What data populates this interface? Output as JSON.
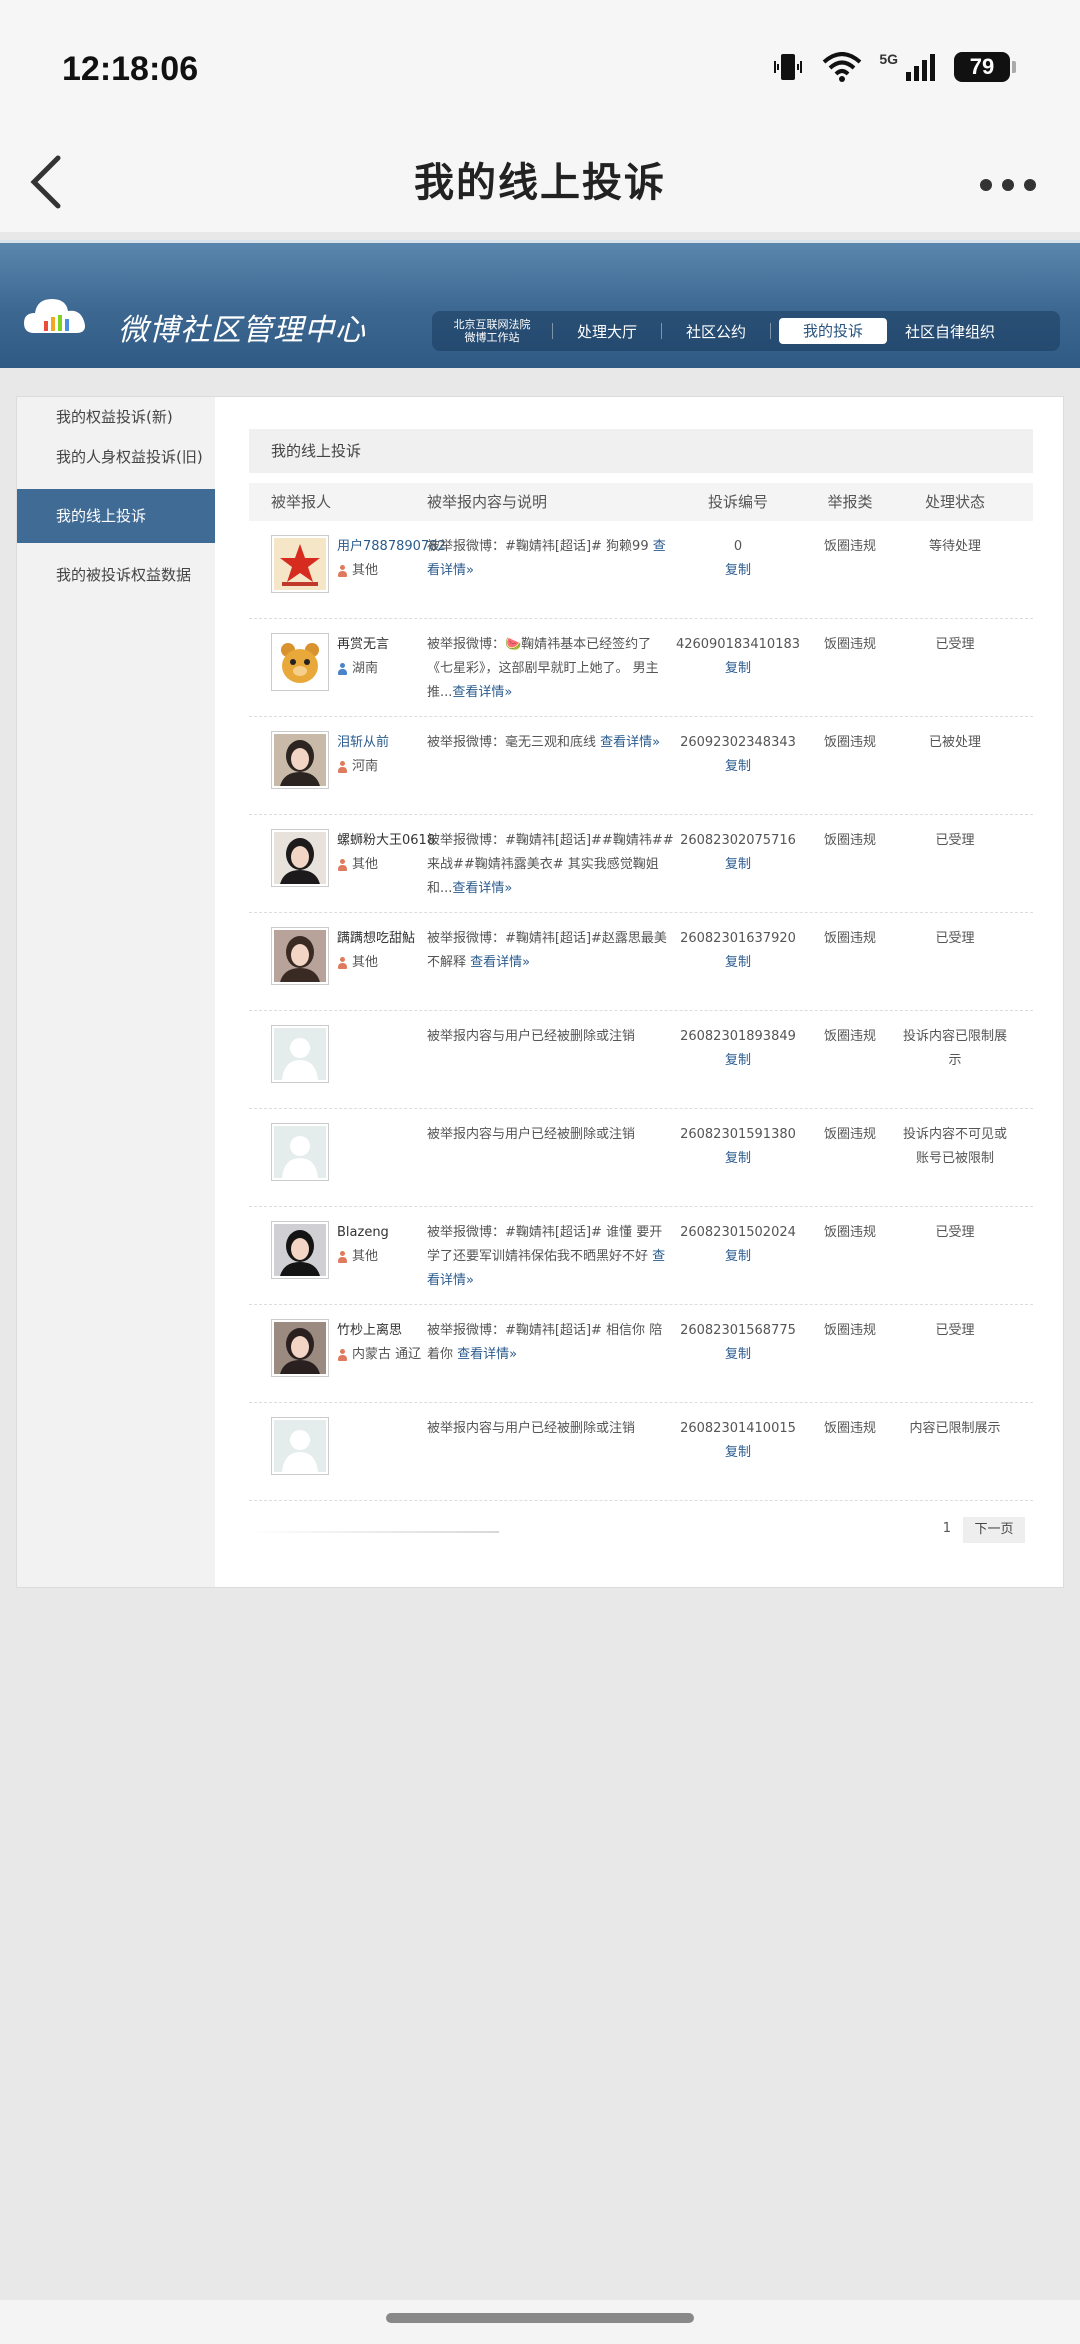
{
  "status_bar": {
    "time": "12:18:06",
    "network": "5G",
    "battery": "79"
  },
  "nav": {
    "title": "我的线上投诉"
  },
  "banner": {
    "title": "微博社区管理中心",
    "court_line1": "北京互联网法院",
    "court_line2": "微博工作站",
    "tabs": [
      "处理大厅",
      "社区公约",
      "我的投诉",
      "社区自律组织"
    ],
    "active_tab": "我的投诉"
  },
  "sidebar": {
    "items": [
      "我的权益投诉(新)",
      "我的人身权益投诉(旧)",
      "我的线上投诉",
      "我的被投诉权益数据"
    ],
    "active": "我的线上投诉"
  },
  "content": {
    "title": "我的线上投诉",
    "headers": [
      "被举报人",
      "被举报内容与说明",
      "投诉编号",
      "举报类",
      "处理状态"
    ],
    "copy_label": "复制",
    "rows": [
      {
        "avatar": "star-logo",
        "name": "用户7887890782",
        "location": "其他",
        "gender": "f",
        "content": "被举报微博：#鞠婧祎[超话]# 狗赖99 ",
        "more": "查看详情»",
        "id": "0",
        "category": "饭圈违规",
        "status": "等待处理"
      },
      {
        "avatar": "bear",
        "name": "再赏无言",
        "location": "湖南",
        "gender": "m",
        "content": "被举报微博：🍉鞠婧祎基本已经签约了《七星彩》，这部剧早就盯上她了。 男主 推...",
        "more": "查看详情»",
        "id": "426090183410183",
        "category": "饭圈违规",
        "status": "已受理"
      },
      {
        "avatar": "girl-1",
        "name": "泪斩从前",
        "location": "河南",
        "gender": "f",
        "content": "被举报微博：毫无三观和底线 ",
        "more": "查看详情»",
        "id": "26092302348343",
        "category": "饭圈违规",
        "status": "已被处理"
      },
      {
        "avatar": "girl-2",
        "name": "螺蛳粉大王0618",
        "location": "其他",
        "gender": "f",
        "content": "被举报微博：#鞠婧祎[超话]##鞠婧祎##来战##鞠婧祎露美衣# 其实我感觉鞠姐和...",
        "more": "查看详情»",
        "id": "26082302075716",
        "category": "饭圈违规",
        "status": "已受理"
      },
      {
        "avatar": "girl-3",
        "name": "蹒蹒想吃甜鮎",
        "location": "其他",
        "gender": "f",
        "content": "被举报微博：#鞠婧祎[超话]#赵露思最美不解释 ",
        "more": "查看详情»",
        "id": "26082301637920",
        "category": "饭圈违规",
        "status": "已受理"
      },
      {
        "avatar": "placeholder",
        "name": "",
        "location": "",
        "gender": "",
        "content": "被举报内容与用户已经被删除或注销",
        "more": "",
        "id": "26082301893849",
        "category": "饭圈违规",
        "status": "投诉内容已限制展示"
      },
      {
        "avatar": "placeholder",
        "name": "",
        "location": "",
        "gender": "",
        "content": "被举报内容与用户已经被删除或注销",
        "more": "",
        "id": "26082301591380",
        "category": "饭圈违规",
        "status": "投诉内容不可见或账号已被限制"
      },
      {
        "avatar": "girl-4",
        "name": "Blazeng",
        "location": "其他",
        "gender": "f",
        "content": "被举报微博：#鞠婧祎[超话]# 谁懂 要开学了还要军训婧祎保佑我不晒黑好不好 ",
        "more": "查看详情»",
        "id": "26082301502024",
        "category": "饭圈违规",
        "status": "已受理"
      },
      {
        "avatar": "girl-5",
        "name": "竹杪上离思",
        "location": "内蒙古 通辽",
        "gender": "f",
        "content": "被举报微博：#鞠婧祎[超话]# 相信你 陪着你 ",
        "more": "查看详情»",
        "id": "26082301568775",
        "category": "饭圈违规",
        "status": "已受理"
      },
      {
        "avatar": "placeholder",
        "name": "",
        "location": "",
        "gender": "",
        "content": "被举报内容与用户已经被删除或注销",
        "more": "",
        "id": "26082301410015",
        "category": "饭圈违规",
        "status": "内容已限制展示"
      }
    ]
  },
  "pager": {
    "page": "1",
    "next": "下一页"
  },
  "colors": {
    "banner": "#3c6791",
    "active_side": "#3f6b95",
    "link": "#2b5b8d"
  }
}
